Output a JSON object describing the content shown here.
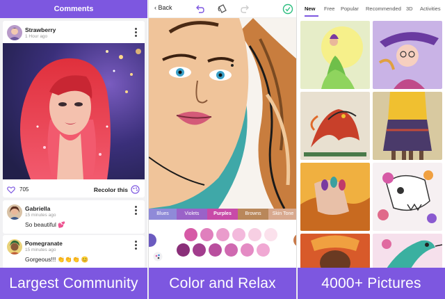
{
  "panel1": {
    "header_title": "Comments",
    "post": {
      "user": "Strawberry",
      "time": "1 Hour ago",
      "likes": "705",
      "recolor_label": "Recolor this"
    },
    "comments": [
      {
        "user": "Gabriella",
        "time": "15 minutes ago",
        "text": "So beautiful 💕"
      },
      {
        "user": "Pomegranate",
        "time": "15 minutes ago",
        "text": "Gorgeous!!! 👏👏👏 😊"
      }
    ],
    "caption": "Largest Community"
  },
  "panel2": {
    "back_label": "Back",
    "palette_tabs": [
      "Blues",
      "Violets",
      "Purples",
      "Browns",
      "Skin Tone"
    ],
    "palette_tab_colors": [
      "#8f8ad8",
      "#9a62c8",
      "#c84aa8",
      "#b9875a",
      "#d8a98f"
    ],
    "active_palette": "Purples",
    "swatch_colors": [
      "#d65aa6",
      "#e07fbd",
      "#ea9ccc",
      "#f3b9dc",
      "#f7cfe3",
      "#fbe1ec",
      "#8a2f79",
      "#a23d8d",
      "#b94f9e",
      "#cf69b0",
      "#e48bc4",
      "#f0a8d3"
    ],
    "caption": "Color and Relax"
  },
  "panel3": {
    "tabs": [
      "New",
      "Free",
      "Popular",
      "Recommended",
      "3D",
      "Activities"
    ],
    "active_tab": "New",
    "caption": "4000+ Pictures"
  },
  "colors": {
    "accent": "#7d57e0",
    "brand_check": "#2bbd7e"
  }
}
